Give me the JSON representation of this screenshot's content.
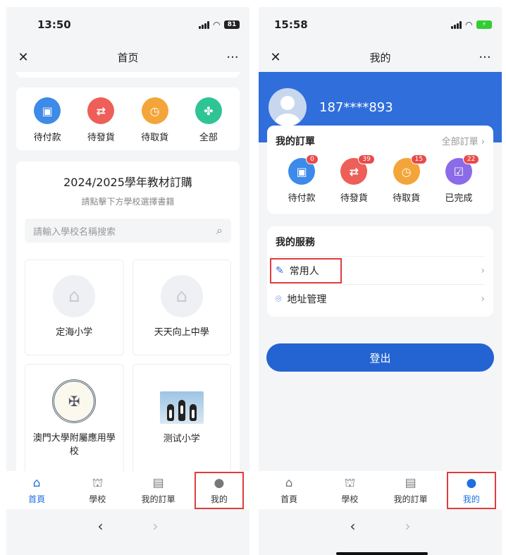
{
  "left": {
    "status": {
      "time": "13:50",
      "battery": "81"
    },
    "title": "首页",
    "orders": [
      {
        "label": "待付款",
        "icon": "wallet-icon",
        "color": "#3d8ae8"
      },
      {
        "label": "待發貨",
        "icon": "ship-icon",
        "color": "#ed5f58"
      },
      {
        "label": "待取貨",
        "icon": "pickup-icon",
        "color": "#f4a53a"
      },
      {
        "label": "全部",
        "icon": "all-icon",
        "color": "#2fc494"
      }
    ],
    "section": {
      "heading": "2024/2025學年教材訂購",
      "subtitle": "請點擊下方學校選擇書籍"
    },
    "search": {
      "placeholder": "請輸入學校名稱搜索"
    },
    "schools": [
      {
        "name": "定海小学"
      },
      {
        "name": "天天向上中學"
      },
      {
        "name": "澳門大學附屬應用學校"
      },
      {
        "name": "测试小学"
      }
    ],
    "tabs": [
      {
        "label": "首頁"
      },
      {
        "label": "學校"
      },
      {
        "label": "我的訂單"
      },
      {
        "label": "我的"
      }
    ]
  },
  "right": {
    "status": {
      "time": "15:58"
    },
    "title": "我的",
    "phone": "187****893",
    "order_card": {
      "title": "我的訂單",
      "all": "全部訂單",
      "items": [
        {
          "label": "待付款",
          "badge": "0",
          "icon": "wallet-icon",
          "color": "#3d8ae8"
        },
        {
          "label": "待發貨",
          "badge": "39",
          "icon": "ship-icon",
          "color": "#ed5f58"
        },
        {
          "label": "待取貨",
          "badge": "15",
          "icon": "pickup-icon",
          "color": "#f4a53a"
        },
        {
          "label": "已完成",
          "badge": "22",
          "icon": "completed-icon",
          "color": "#8b6be8"
        }
      ]
    },
    "services": {
      "title": "我的服務",
      "items": [
        {
          "label": "常用人",
          "icon": "edit-icon"
        },
        {
          "label": "地址管理",
          "icon": "location-icon"
        }
      ]
    },
    "logout": "登出",
    "tabs": [
      {
        "label": "首頁"
      },
      {
        "label": "學校"
      },
      {
        "label": "我的訂單"
      },
      {
        "label": "我的"
      }
    ]
  },
  "accent": "#2f6edb",
  "highlight": "#e23b3b"
}
